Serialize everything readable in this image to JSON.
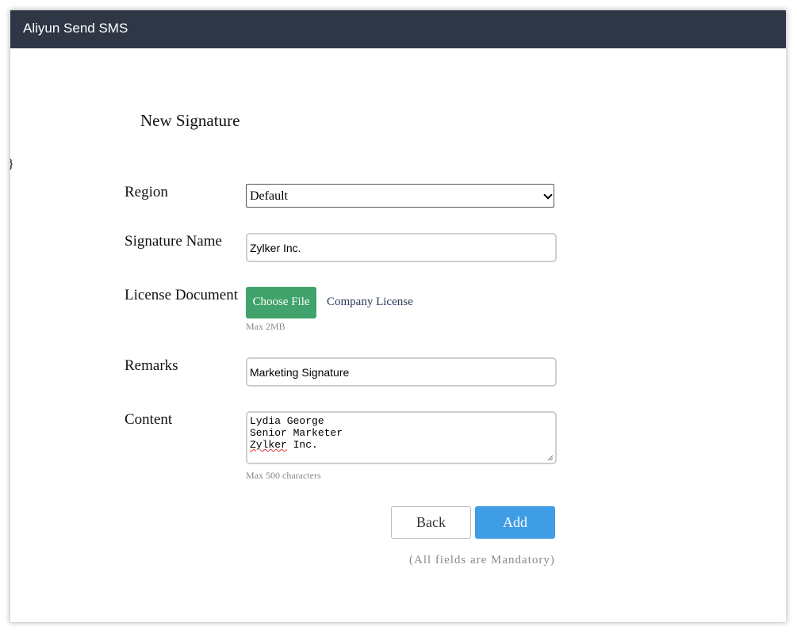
{
  "app": {
    "title": "Aliyun Send SMS"
  },
  "page": {
    "heading": "New Signature",
    "stray_text": "}"
  },
  "form": {
    "region": {
      "label": "Region",
      "selected": "Default"
    },
    "signature_name": {
      "label": "Signature Name",
      "value": "Zylker Inc."
    },
    "license": {
      "label": "License Document",
      "button_label": "Choose File",
      "file_name": "Company License",
      "hint": "Max 2MB"
    },
    "remarks": {
      "label": "Remarks",
      "value": "Marketing Signature"
    },
    "content": {
      "label": "Content",
      "lines": [
        "Lydia George",
        "Senior Marketer"
      ],
      "line3_word": "Zylker",
      "line3_rest": " Inc.",
      "hint": "Max 500 characters"
    }
  },
  "actions": {
    "back_label": "Back",
    "add_label": "Add",
    "note": "(All fields are Mandatory)"
  },
  "colors": {
    "header_bg": "#2f3747",
    "choose_file_bg": "#41a36b",
    "add_button_bg": "#3f9de6"
  },
  "icons": {
    "select_arrow": "chevron-down-icon",
    "resize_handle": "resize-grip-icon"
  }
}
